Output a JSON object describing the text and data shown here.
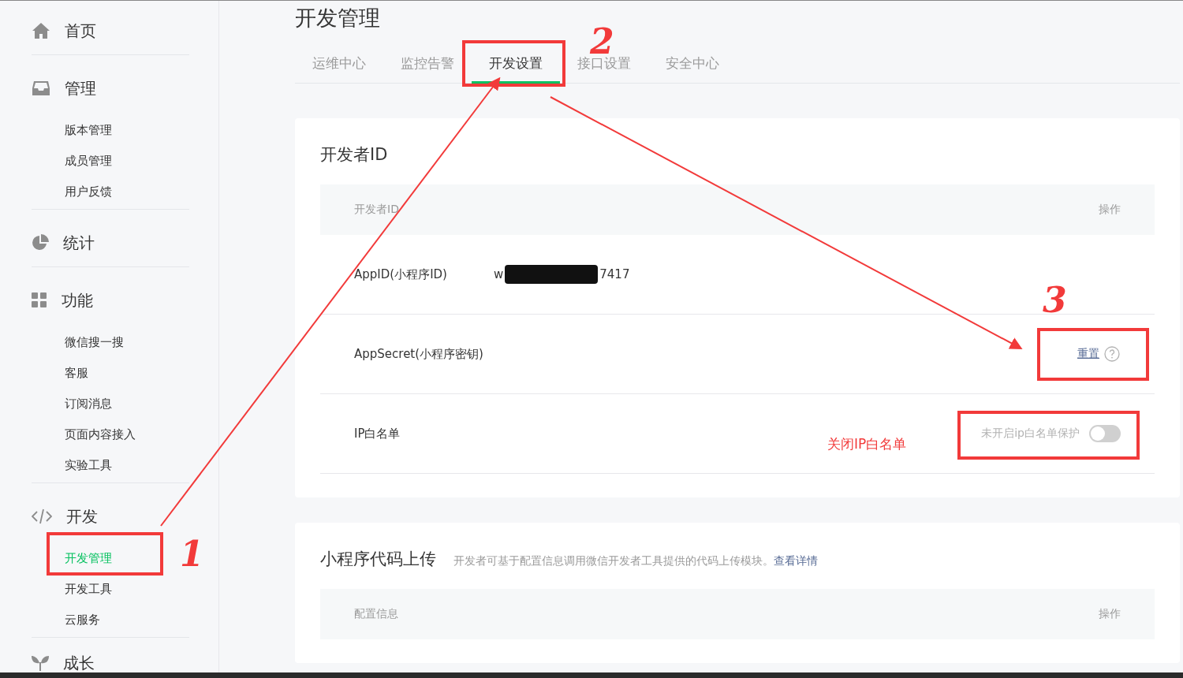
{
  "sidebar": {
    "sections": [
      {
        "label": "首页"
      },
      {
        "label": "管理",
        "items": [
          {
            "label": "版本管理",
            "selected": false
          },
          {
            "label": "成员管理",
            "selected": false
          },
          {
            "label": "用户反馈",
            "selected": false
          }
        ]
      },
      {
        "label": "统计"
      },
      {
        "label": "功能",
        "items": [
          {
            "label": "微信搜一搜",
            "selected": false
          },
          {
            "label": "客服",
            "selected": false
          },
          {
            "label": "订阅消息",
            "selected": false
          },
          {
            "label": "页面内容接入",
            "selected": false
          },
          {
            "label": "实验工具",
            "selected": false
          }
        ]
      },
      {
        "label": "开发",
        "items": [
          {
            "label": "开发管理",
            "selected": true
          },
          {
            "label": "开发工具",
            "selected": false
          },
          {
            "label": "云服务",
            "selected": false
          }
        ]
      },
      {
        "label": "成长"
      }
    ]
  },
  "page_title": "开发管理",
  "tabs": [
    {
      "label": "运维中心",
      "selected": false
    },
    {
      "label": "监控告警",
      "selected": false
    },
    {
      "label": "开发设置",
      "selected": true
    },
    {
      "label": "接口设置",
      "selected": false
    },
    {
      "label": "安全中心",
      "selected": false
    }
  ],
  "developer_card": {
    "title": "开发者ID",
    "columns": [
      "开发者ID",
      "操作"
    ],
    "rows": [
      {
        "kind": "value",
        "label": "AppID(小程序ID)",
        "value_start": "w",
        "value_end": "7417",
        "redacted": true
      },
      {
        "kind": "action",
        "label": "AppSecret(小程序密钥)",
        "action": "重置"
      },
      {
        "kind": "switch",
        "label": "IP白名单",
        "switch_label": "未开启ip白名单保护",
        "on": false
      }
    ]
  },
  "upload_card": {
    "title": "小程序代码上传",
    "description": "开发者可基于配置信息调用微信开发者工具提供的代码上传模块。",
    "link": "查看详情",
    "columns": [
      "配置信息",
      "操作"
    ]
  },
  "annotations": {
    "numbers": [
      "1",
      "2",
      "3"
    ],
    "note": "关闭IP白名单"
  }
}
